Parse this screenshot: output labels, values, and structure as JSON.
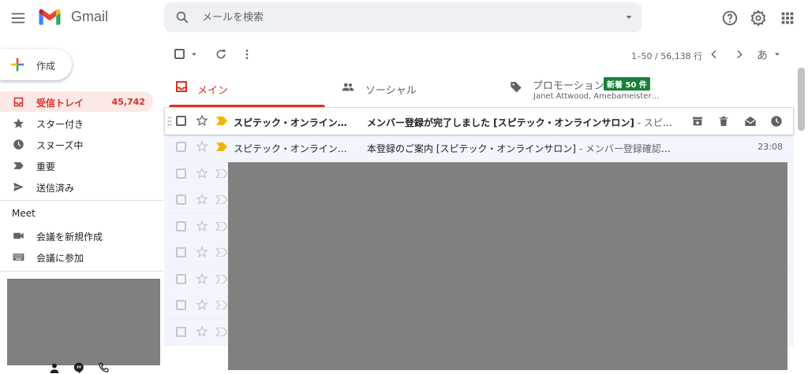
{
  "app": {
    "name": "Gmail"
  },
  "search": {
    "placeholder": "メールを検索"
  },
  "compose": {
    "label": "作成"
  },
  "sidebar": {
    "items": [
      {
        "label": "受信トレイ",
        "count": "45,742",
        "icon": "inbox-icon",
        "active": true
      },
      {
        "label": "スター付き",
        "icon": "star-icon"
      },
      {
        "label": "スヌーズ中",
        "icon": "clock-icon"
      },
      {
        "label": "重要",
        "icon": "important-icon"
      },
      {
        "label": "送信済み",
        "icon": "send-icon"
      }
    ],
    "meet": {
      "title": "Meet",
      "items": [
        {
          "label": "会議を新規作成",
          "icon": "video-camera-icon"
        },
        {
          "label": "会議に参加",
          "icon": "keyboard-icon"
        }
      ]
    }
  },
  "toolbar": {
    "pagination": "1–50 / 56,138 行",
    "input_tool": "あ"
  },
  "tabs": [
    {
      "label": "メイン",
      "icon": "inbox-icon",
      "active": true
    },
    {
      "label": "ソーシャル",
      "icon": "people-icon"
    },
    {
      "label": "プロモーション",
      "icon": "tag-icon",
      "badge": "新着 50 件",
      "subtitle": "Janet Attwood, Amebameister…"
    }
  ],
  "emails": [
    {
      "sender": "スピテック・オンライン…",
      "subject": "メンバー登録が完了しました [スピテック・オンラインサロン]",
      "snippet": " - スピテ…",
      "unread": true,
      "hover": true,
      "important": true
    },
    {
      "sender": "スピテック・オンライン…",
      "subject": "本登録のご案内 [スピテック・オンラインサロン]",
      "snippet": " - メンバー登録確認メールです。 …",
      "date": "23:08",
      "unread": false,
      "important": true
    }
  ],
  "colors": {
    "accent": "#d93025",
    "active_bg": "#fce8e6",
    "badge": "#188038"
  }
}
